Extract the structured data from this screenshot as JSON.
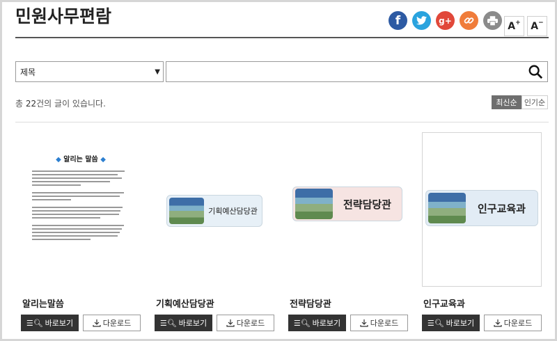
{
  "header": {
    "title": "민원사무편람",
    "share_icons": [
      "facebook-icon",
      "twitter-icon",
      "google-plus-icon",
      "link-icon",
      "print-icon"
    ],
    "font_plus": "A",
    "font_minus": "A"
  },
  "search": {
    "select_value": "제목",
    "input_value": "",
    "placeholder": ""
  },
  "summary": {
    "prefix": "총 ",
    "count": "22",
    "suffix": "건의 글이 있습니다."
  },
  "sort": {
    "active": "최신순",
    "other": "인기순"
  },
  "cards": [
    {
      "title": "알리는말씀",
      "thumb_heading": "알리는 말씀",
      "view_label": "바로보기",
      "download_label": "다운로드"
    },
    {
      "title": "기획예산담당관",
      "banner_text": "기획예산담당관",
      "view_label": "바로보기",
      "download_label": "다운로드"
    },
    {
      "title": "전략담당관",
      "banner_text": "전략담당관",
      "view_label": "바로보기",
      "download_label": "다운로드"
    },
    {
      "title": "인구교육과",
      "banner_text": "인구교육과",
      "view_label": "바로보기",
      "download_label": "다운로드"
    }
  ],
  "colors": {
    "facebook": "#2d5aa3",
    "twitter": "#2aa3de",
    "google_plus": "#e1483a",
    "link": "#f07c3a",
    "print": "#8b8b8b",
    "button_dark": "#333333"
  }
}
